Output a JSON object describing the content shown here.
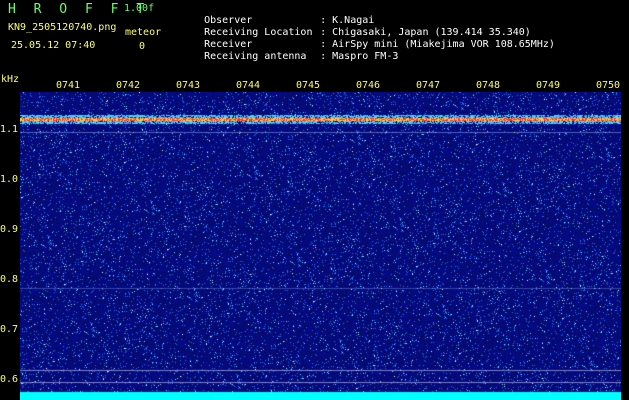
{
  "header": {
    "brand": "H R O F F T",
    "version": "1.00f",
    "filename": "KN9_2505120740.png",
    "datetime": "25.05.12 07:40",
    "meteor_label": "meteor",
    "meteor_count": "0"
  },
  "info": [
    {
      "key": "Observer",
      "value": ": K.Nagai"
    },
    {
      "key": "Receiving Location",
      "value": ": Chigasaki, Japan (139.414 35.340)"
    },
    {
      "key": "Receiver",
      "value": ": AirSpy mini (Miakejima VOR 108.65MHz)"
    },
    {
      "key": "Receiving antenna",
      "value": ": Maspro FM-3"
    }
  ],
  "axes": {
    "y_title": "kHz",
    "y_ticks": [
      "1.1",
      "1.0",
      "0.9",
      "0.8",
      "0.7",
      "0.6"
    ],
    "x_ticks": [
      "0741",
      "0742",
      "0743",
      "0744",
      "0745",
      "0746",
      "0747",
      "0748",
      "0749",
      "0750"
    ]
  },
  "colors": {
    "background": "#000000",
    "label_yellow": "#ffff66",
    "label_green": "#66ff66",
    "noise_blue": "#1a1aa0",
    "carrier_red": "#ff3030",
    "carrier_cyan": "#40e0ff",
    "bottom_cyan": "#00ffff"
  }
}
